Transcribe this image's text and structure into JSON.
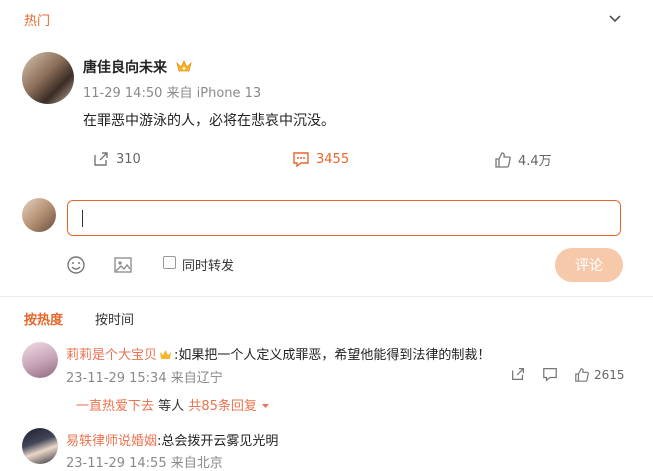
{
  "header": {
    "section_title": "热门"
  },
  "post": {
    "author": "唐佳良向未来",
    "time": "11-29 14:50",
    "source": "来自 iPhone 13",
    "text": "在罪恶中游泳的人，必将在悲哀中沉没。",
    "forward_count": "310",
    "comment_count": "3455",
    "like_count": "4.4万"
  },
  "composer": {
    "forward_label": "同时转发",
    "submit_label": "评论"
  },
  "sort": {
    "hot_label": "按热度",
    "time_label": "按时间"
  },
  "comments": [
    {
      "user": "莉莉是个大宝贝",
      "text": ":如果把一个人定义成罪恶，希望他能得到法律的制裁！",
      "time": "23-11-29 15:34",
      "location": "来自辽宁",
      "like_count": "2615",
      "reply_user": "一直热爱下去",
      "reply_mid": "等人",
      "reply_count": "共85条回复"
    },
    {
      "user": "易轶律师说婚姻",
      "text": ":总会拨开云雾见光明",
      "time": "23-11-29 14:55",
      "location": "来自北京"
    }
  ],
  "colors": {
    "accent": "#e6672d",
    "username": "#eb7350",
    "submit_disabled": "#f7c9ab"
  }
}
